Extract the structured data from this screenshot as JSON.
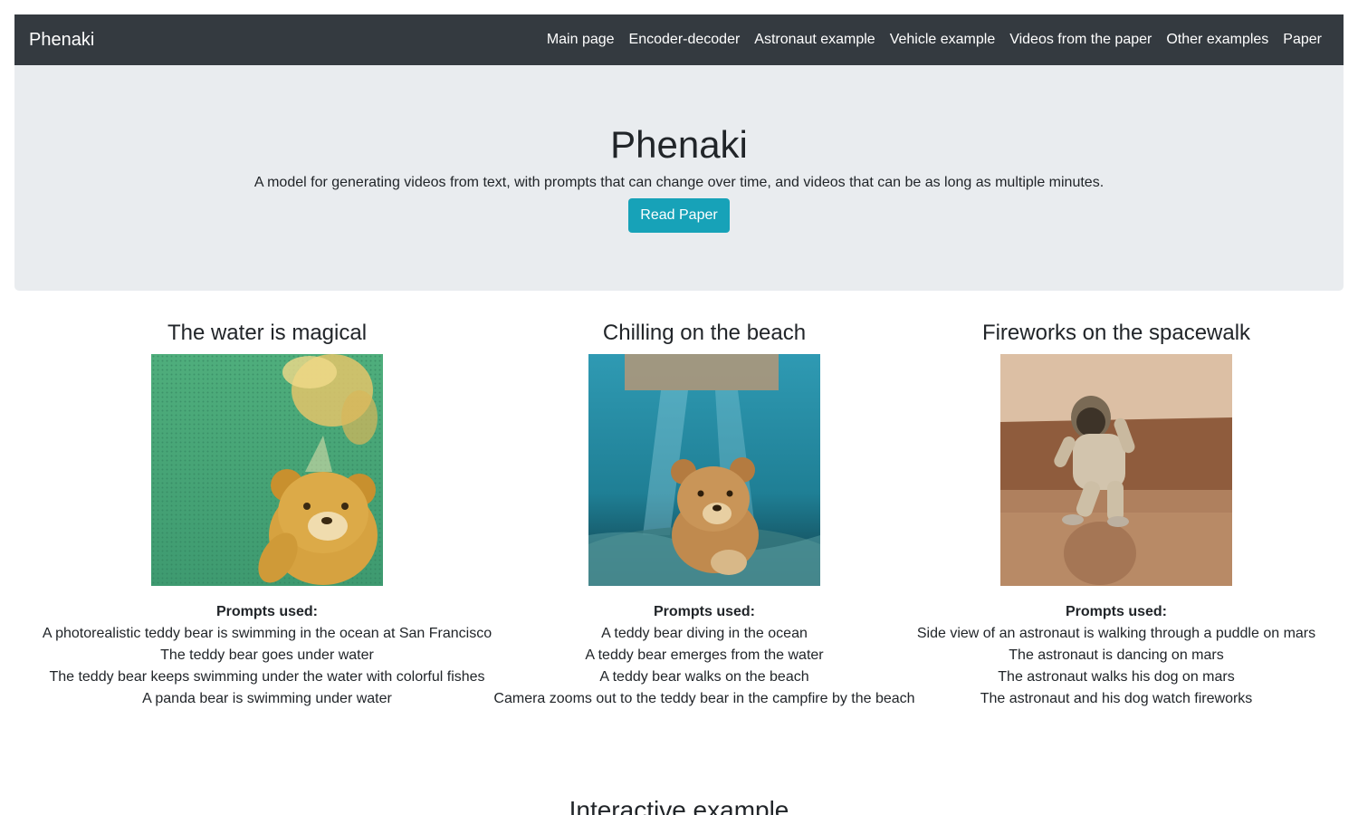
{
  "navbar": {
    "brand": "Phenaki",
    "links": [
      {
        "label": "Main page"
      },
      {
        "label": "Encoder-decoder"
      },
      {
        "label": "Astronaut example"
      },
      {
        "label": "Vehicle example"
      },
      {
        "label": "Videos from the paper"
      },
      {
        "label": "Other examples"
      },
      {
        "label": "Paper"
      }
    ],
    "background": "#343a40"
  },
  "hero": {
    "title": "Phenaki",
    "subtitle": "A model for generating videos from text, with prompts that can change over time, and videos that can be as long as multiple minutes.",
    "button_label": "Read Paper",
    "button_color": "#17a2b8",
    "background": "#e9ecef"
  },
  "examples": [
    {
      "title": "The water is magical",
      "media": "teddy-bear-underwater-video",
      "prompts_heading": "Prompts used:",
      "prompts": [
        "A photorealistic teddy bear is swimming in the ocean at San Francisco",
        "The teddy bear goes under water",
        "The teddy bear keeps swimming under the water with colorful fishes",
        "A panda bear is swimming under water"
      ]
    },
    {
      "title": "Chilling on the beach",
      "media": "teddy-bear-diving-video",
      "prompts_heading": "Prompts used:",
      "prompts": [
        "A teddy bear diving in the ocean",
        "A teddy bear emerges from the water",
        "A teddy bear walks on the beach",
        "Camera zooms out to the teddy bear in the campfire by the beach"
      ]
    },
    {
      "title": "Fireworks on the spacewalk",
      "media": "astronaut-on-mars-video",
      "prompts_heading": "Prompts used:",
      "prompts": [
        "Side view of an astronaut is walking through a puddle on mars",
        "The astronaut is dancing on mars",
        "The astronaut walks his dog on mars",
        "The astronaut and his dog watch fireworks"
      ]
    }
  ],
  "interactive_section": {
    "heading": "Interactive example"
  }
}
